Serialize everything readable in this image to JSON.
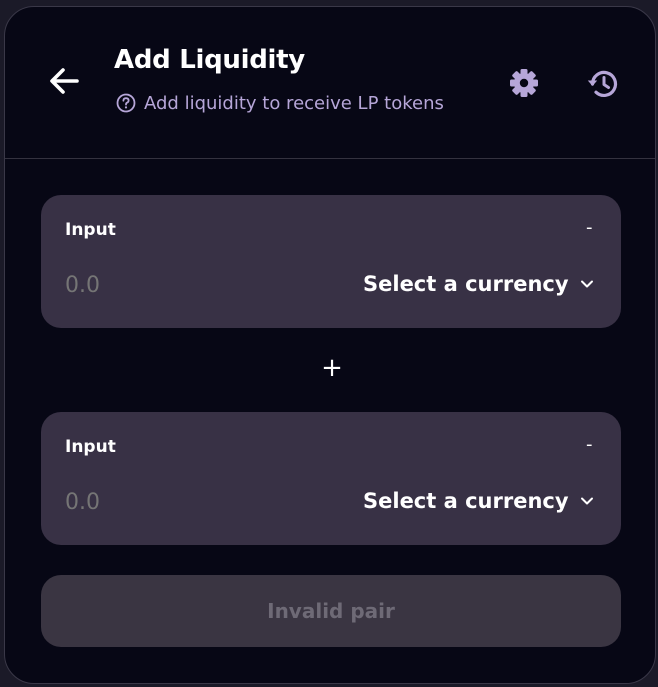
{
  "header": {
    "title": "Add Liquidity",
    "subtitle": "Add liquidity to receive LP tokens",
    "back_icon": "arrow-left-icon",
    "help_icon": "question-circle-icon",
    "settings_icon": "gear-icon",
    "history_icon": "history-icon"
  },
  "panels": [
    {
      "label": "Input",
      "balance": "-",
      "amount_placeholder": "0.0",
      "currency_label": "Select a currency"
    },
    {
      "label": "Input",
      "balance": "-",
      "amount_placeholder": "0.0",
      "currency_label": "Select a currency"
    }
  ],
  "separator": "+",
  "action_button": {
    "label": "Invalid pair"
  },
  "colors": {
    "background": "#070715",
    "panel": "#383145",
    "accent_text": "#b6a6d8",
    "disabled_button": "#3a3542",
    "disabled_text": "#6e6a76"
  }
}
